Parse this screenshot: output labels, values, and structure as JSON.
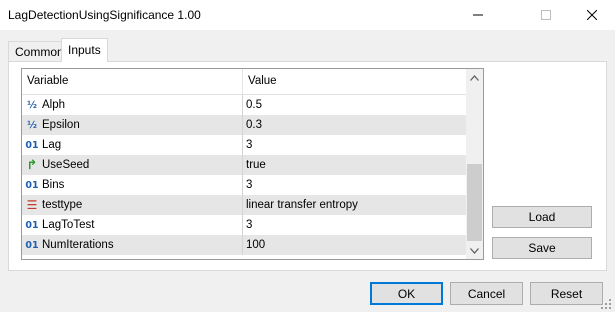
{
  "window": {
    "title": "LagDetectionUsingSignificance 1.00",
    "minimize_icon": "minimize-icon",
    "maximize_icon": "maximize-icon",
    "close_icon": "close-icon"
  },
  "tabs": [
    {
      "label": "Common",
      "active": false
    },
    {
      "label": "Inputs",
      "active": true
    }
  ],
  "grid": {
    "headers": {
      "variable": "Variable",
      "value": "Value"
    },
    "rows": [
      {
        "icon": "fraction-icon",
        "glyph": "½",
        "variable": "Alph",
        "value": "0.5"
      },
      {
        "icon": "fraction-icon",
        "glyph": "½",
        "variable": "Epsilon",
        "value": "0.3"
      },
      {
        "icon": "integer-icon",
        "glyph": "01",
        "variable": "Lag",
        "value": "3"
      },
      {
        "icon": "boolean-arrow-icon",
        "glyph": "↱",
        "variable": "UseSeed",
        "value": "true"
      },
      {
        "icon": "integer-icon",
        "glyph": "01",
        "variable": "Bins",
        "value": "3"
      },
      {
        "icon": "enum-list-icon",
        "glyph": "☰",
        "variable": "testtype",
        "value": "linear transfer entropy"
      },
      {
        "icon": "integer-icon",
        "glyph": "01",
        "variable": "LagToTest",
        "value": "3"
      },
      {
        "icon": "integer-icon",
        "glyph": "01",
        "variable": "NumIterations",
        "value": "100"
      }
    ]
  },
  "buttons": {
    "load": "Load",
    "save": "Save",
    "ok": "OK",
    "cancel": "Cancel",
    "reset": "Reset"
  },
  "colors": {
    "accent": "#0078d7",
    "row_alt": "#e6e6e6",
    "icon_blue": "#1f5fb0",
    "icon_green": "#2e9a2e",
    "icon_red": "#c0392b"
  }
}
